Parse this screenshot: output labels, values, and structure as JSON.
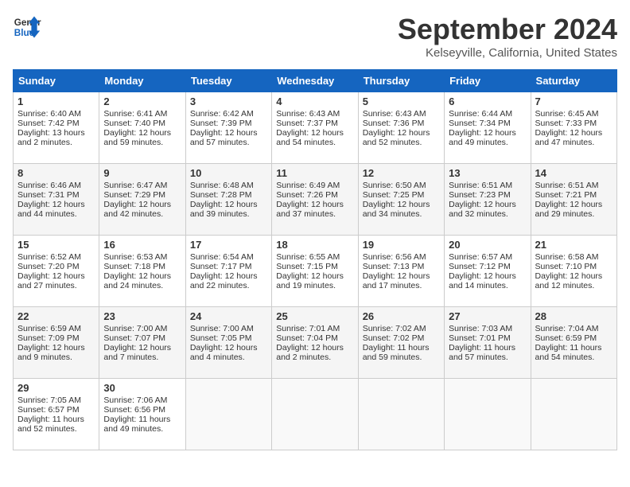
{
  "header": {
    "logo_line1": "General",
    "logo_line2": "Blue",
    "title": "September 2024",
    "subtitle": "Kelseyville, California, United States"
  },
  "columns": [
    "Sunday",
    "Monday",
    "Tuesday",
    "Wednesday",
    "Thursday",
    "Friday",
    "Saturday"
  ],
  "weeks": [
    [
      {
        "day": "1",
        "sunrise": "6:40 AM",
        "sunset": "7:42 PM",
        "daylight": "13 hours and 2 minutes."
      },
      {
        "day": "2",
        "sunrise": "6:41 AM",
        "sunset": "7:40 PM",
        "daylight": "12 hours and 59 minutes."
      },
      {
        "day": "3",
        "sunrise": "6:42 AM",
        "sunset": "7:39 PM",
        "daylight": "12 hours and 57 minutes."
      },
      {
        "day": "4",
        "sunrise": "6:43 AM",
        "sunset": "7:37 PM",
        "daylight": "12 hours and 54 minutes."
      },
      {
        "day": "5",
        "sunrise": "6:43 AM",
        "sunset": "7:36 PM",
        "daylight": "12 hours and 52 minutes."
      },
      {
        "day": "6",
        "sunrise": "6:44 AM",
        "sunset": "7:34 PM",
        "daylight": "12 hours and 49 minutes."
      },
      {
        "day": "7",
        "sunrise": "6:45 AM",
        "sunset": "7:33 PM",
        "daylight": "12 hours and 47 minutes."
      }
    ],
    [
      {
        "day": "8",
        "sunrise": "6:46 AM",
        "sunset": "7:31 PM",
        "daylight": "12 hours and 44 minutes."
      },
      {
        "day": "9",
        "sunrise": "6:47 AM",
        "sunset": "7:29 PM",
        "daylight": "12 hours and 42 minutes."
      },
      {
        "day": "10",
        "sunrise": "6:48 AM",
        "sunset": "7:28 PM",
        "daylight": "12 hours and 39 minutes."
      },
      {
        "day": "11",
        "sunrise": "6:49 AM",
        "sunset": "7:26 PM",
        "daylight": "12 hours and 37 minutes."
      },
      {
        "day": "12",
        "sunrise": "6:50 AM",
        "sunset": "7:25 PM",
        "daylight": "12 hours and 34 minutes."
      },
      {
        "day": "13",
        "sunrise": "6:51 AM",
        "sunset": "7:23 PM",
        "daylight": "12 hours and 32 minutes."
      },
      {
        "day": "14",
        "sunrise": "6:51 AM",
        "sunset": "7:21 PM",
        "daylight": "12 hours and 29 minutes."
      }
    ],
    [
      {
        "day": "15",
        "sunrise": "6:52 AM",
        "sunset": "7:20 PM",
        "daylight": "12 hours and 27 minutes."
      },
      {
        "day": "16",
        "sunrise": "6:53 AM",
        "sunset": "7:18 PM",
        "daylight": "12 hours and 24 minutes."
      },
      {
        "day": "17",
        "sunrise": "6:54 AM",
        "sunset": "7:17 PM",
        "daylight": "12 hours and 22 minutes."
      },
      {
        "day": "18",
        "sunrise": "6:55 AM",
        "sunset": "7:15 PM",
        "daylight": "12 hours and 19 minutes."
      },
      {
        "day": "19",
        "sunrise": "6:56 AM",
        "sunset": "7:13 PM",
        "daylight": "12 hours and 17 minutes."
      },
      {
        "day": "20",
        "sunrise": "6:57 AM",
        "sunset": "7:12 PM",
        "daylight": "12 hours and 14 minutes."
      },
      {
        "day": "21",
        "sunrise": "6:58 AM",
        "sunset": "7:10 PM",
        "daylight": "12 hours and 12 minutes."
      }
    ],
    [
      {
        "day": "22",
        "sunrise": "6:59 AM",
        "sunset": "7:09 PM",
        "daylight": "12 hours and 9 minutes."
      },
      {
        "day": "23",
        "sunrise": "7:00 AM",
        "sunset": "7:07 PM",
        "daylight": "12 hours and 7 minutes."
      },
      {
        "day": "24",
        "sunrise": "7:00 AM",
        "sunset": "7:05 PM",
        "daylight": "12 hours and 4 minutes."
      },
      {
        "day": "25",
        "sunrise": "7:01 AM",
        "sunset": "7:04 PM",
        "daylight": "12 hours and 2 minutes."
      },
      {
        "day": "26",
        "sunrise": "7:02 AM",
        "sunset": "7:02 PM",
        "daylight": "11 hours and 59 minutes."
      },
      {
        "day": "27",
        "sunrise": "7:03 AM",
        "sunset": "7:01 PM",
        "daylight": "11 hours and 57 minutes."
      },
      {
        "day": "28",
        "sunrise": "7:04 AM",
        "sunset": "6:59 PM",
        "daylight": "11 hours and 54 minutes."
      }
    ],
    [
      {
        "day": "29",
        "sunrise": "7:05 AM",
        "sunset": "6:57 PM",
        "daylight": "11 hours and 52 minutes."
      },
      {
        "day": "30",
        "sunrise": "7:06 AM",
        "sunset": "6:56 PM",
        "daylight": "11 hours and 49 minutes."
      },
      null,
      null,
      null,
      null,
      null
    ]
  ]
}
